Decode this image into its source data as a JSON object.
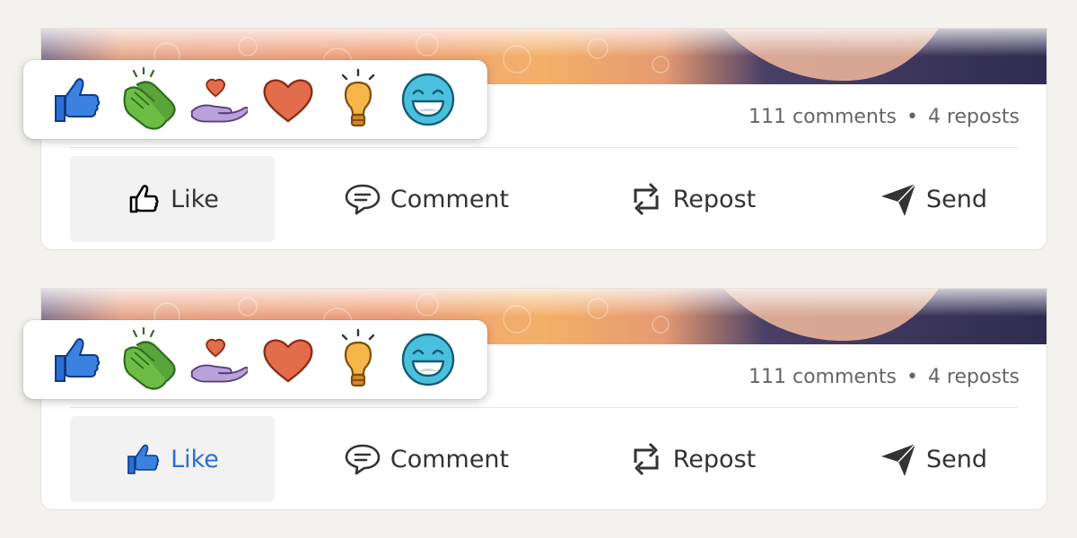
{
  "posts": [
    {
      "stats": {
        "comments": "111 comments",
        "separator": "•",
        "reposts": "4 reposts"
      },
      "actions": {
        "like": "Like",
        "comment": "Comment",
        "repost": "Repost",
        "send": "Send"
      },
      "like_state": "default",
      "reactions": [
        "like",
        "celebrate",
        "support",
        "love",
        "insightful",
        "funny"
      ]
    },
    {
      "stats": {
        "comments": "111 comments",
        "separator": "•",
        "reposts": "4 reposts"
      },
      "actions": {
        "like": "Like",
        "comment": "Comment",
        "repost": "Repost",
        "send": "Send"
      },
      "like_state": "selected",
      "reactions": [
        "like",
        "celebrate",
        "support",
        "love",
        "insightful",
        "funny"
      ]
    }
  ],
  "colors": {
    "like_blue": "#2a6fd6",
    "celebrate_green": "#5aa53a",
    "support_purple": "#b9a2d9",
    "love_red": "#e36c4b",
    "insightful_yellow": "#f5b548",
    "funny_teal": "#3fb7d4",
    "text_gray": "#666666",
    "background": "#f3f2ef"
  },
  "icons": {
    "reactions": [
      "thumbs-up-icon",
      "clapping-hands-icon",
      "heart-in-hand-icon",
      "heart-icon",
      "lightbulb-icon",
      "laughing-face-icon"
    ],
    "actions": [
      "thumbs-up-outline-icon",
      "speech-bubble-icon",
      "repost-arrows-icon",
      "paper-plane-icon"
    ]
  }
}
